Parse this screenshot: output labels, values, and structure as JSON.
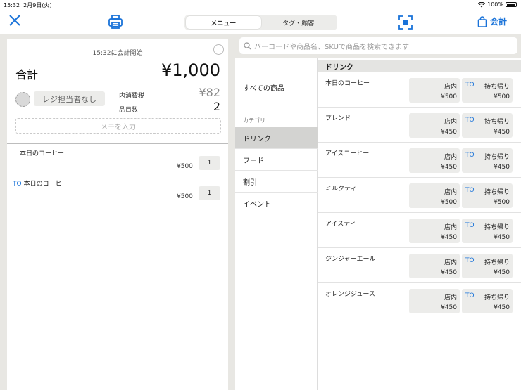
{
  "status": {
    "time": "15:32",
    "date": "2月9日(火)",
    "battery": "100%"
  },
  "nav": {
    "segments": [
      "メニュー",
      "タグ・顧客"
    ],
    "checkout_label": "会計"
  },
  "order": {
    "started": "15:32に会計開始",
    "total_label": "合計",
    "total_value": "¥1,000",
    "staff": "レジ担当者なし",
    "tax_label": "内消費税",
    "tax_value": "¥82",
    "count_label": "品目数",
    "count_value": "2",
    "memo_placeholder": "メモを入力",
    "items": [
      {
        "tag": "",
        "name": "本日のコーヒー",
        "price": "¥500",
        "qty": "1"
      },
      {
        "tag": "TO",
        "name": "本日のコーヒー",
        "price": "¥500",
        "qty": "1"
      }
    ]
  },
  "search": {
    "placeholder": "バーコードや商品名、SKUで商品を検索できます"
  },
  "categories": {
    "all": "すべての商品",
    "header": "カテゴリ",
    "items": [
      "ドリンク",
      "フード",
      "割引",
      "イベント"
    ]
  },
  "products": {
    "header": "ドリンク",
    "in_label": "店内",
    "to_tag": "TO",
    "to_label": "持ち帰り",
    "items": [
      {
        "name": "本日のコーヒー",
        "in_price": "¥500",
        "to_price": "¥500"
      },
      {
        "name": "ブレンド",
        "in_price": "¥450",
        "to_price": "¥450"
      },
      {
        "name": "アイスコーヒー",
        "in_price": "¥450",
        "to_price": "¥450"
      },
      {
        "name": "ミルクティー",
        "in_price": "¥500",
        "to_price": "¥500"
      },
      {
        "name": "アイスティー",
        "in_price": "¥450",
        "to_price": "¥450"
      },
      {
        "name": "ジンジャーエール",
        "in_price": "¥450",
        "to_price": "¥450"
      },
      {
        "name": "オレンジジュース",
        "in_price": "¥450",
        "to_price": "¥450"
      }
    ]
  },
  "colors": {
    "accent": "#1a73d9",
    "pane_bg": "#e8e7e3",
    "button_bg": "#ececea"
  },
  "icons": [
    "close-icon",
    "printer-icon",
    "scan-icon",
    "bag-icon",
    "search-icon",
    "wifi-icon",
    "battery-icon"
  ]
}
